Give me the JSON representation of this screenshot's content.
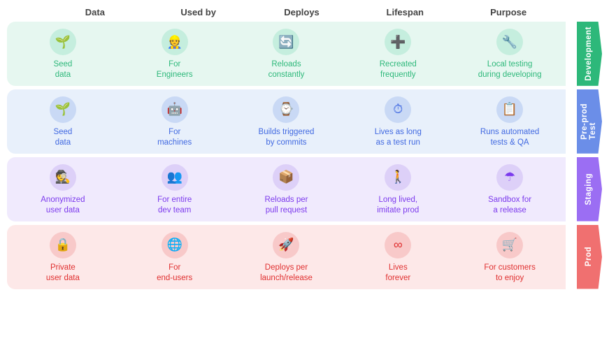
{
  "header": {
    "cols": [
      "Data",
      "Used by",
      "Deploys",
      "Lifespan",
      "Purpose"
    ]
  },
  "rows": [
    {
      "id": "dev",
      "label": "Development",
      "colorClass": "row-dev",
      "labelClass": "row-dev-label",
      "labelBg": "#2db87a",
      "cells": [
        {
          "icon": "🌱",
          "text": "Seed\ndata"
        },
        {
          "icon": "👷",
          "text": "For\nEngineers"
        },
        {
          "icon": "🔄",
          "text": "Reloads\nconstantly"
        },
        {
          "icon": "➕",
          "text": "Recreated\nfrequently"
        },
        {
          "icon": "🔧",
          "text": "Local testing\nduring developing"
        }
      ]
    },
    {
      "id": "test",
      "label": "Pre-prod",
      "sublabel": "Test",
      "colorClass": "row-test",
      "labelClass": "row-test-label",
      "labelBg": "#6b8ee8",
      "cells": [
        {
          "icon": "🌱",
          "text": "Seed\ndata"
        },
        {
          "icon": "🤖",
          "text": "For\nmachines"
        },
        {
          "icon": "⌚",
          "text": "Builds triggered\nby commits"
        },
        {
          "icon": "⏱",
          "text": "Lives as long\nas a test run"
        },
        {
          "icon": "📋",
          "text": "Runs automated\ntests & QA"
        }
      ]
    },
    {
      "id": "staging",
      "label": "Staging",
      "colorClass": "row-staging",
      "labelClass": "row-staging-label",
      "labelBg": "#9b6ef3",
      "cells": [
        {
          "icon": "🕵",
          "text": "Anonymized\nuser data"
        },
        {
          "icon": "👥",
          "text": "For entire\ndev team"
        },
        {
          "icon": "📦",
          "text": "Reloads per\npull request"
        },
        {
          "icon": "🚶",
          "text": "Long lived,\nimitate prod"
        },
        {
          "icon": "☂",
          "text": "Sandbox for\na release"
        }
      ]
    },
    {
      "id": "prod",
      "label": "Prod",
      "colorClass": "row-prod",
      "labelClass": "row-prod-label",
      "labelBg": "#f07070",
      "cells": [
        {
          "icon": "🔒",
          "text": "Private\nuser data"
        },
        {
          "icon": "🌐",
          "text": "For\nend-users"
        },
        {
          "icon": "🚀",
          "text": "Deploys per\nlaunch/release"
        },
        {
          "icon": "∞",
          "text": "Lives\nforever"
        },
        {
          "icon": "🛒",
          "text": "For customers\nto enjoy"
        }
      ]
    }
  ]
}
